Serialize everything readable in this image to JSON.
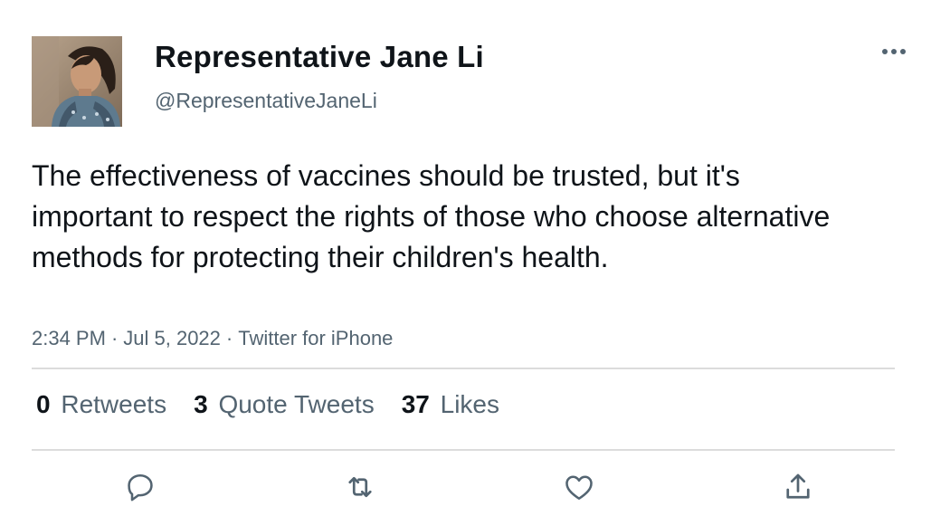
{
  "author": {
    "display_name": "Representative Jane Li",
    "handle": "@RepresentativeJaneLi",
    "avatar_icon": "profile-photo"
  },
  "tweet": {
    "text": "The effectiveness of vaccines should be trusted, but it's important to respect the rights of those who choose alternative methods for protecting their children's health.",
    "time": "2:34 PM",
    "date": "Jul 5, 2022",
    "source": "Twitter for iPhone",
    "separator": "·"
  },
  "stats": {
    "retweets": {
      "count": "0",
      "label": "Retweets"
    },
    "quote_tweets": {
      "count": "3",
      "label": "Quote Tweets"
    },
    "likes": {
      "count": "37",
      "label": "Likes"
    }
  },
  "actions": {
    "reply_icon": "reply-icon",
    "retweet_icon": "retweet-icon",
    "like_icon": "heart-icon",
    "share_icon": "share-icon",
    "more_icon": "more-options-icon"
  },
  "colors": {
    "text_primary": "#0f1419",
    "text_secondary": "#536471",
    "divider": "#dcdcdc"
  }
}
